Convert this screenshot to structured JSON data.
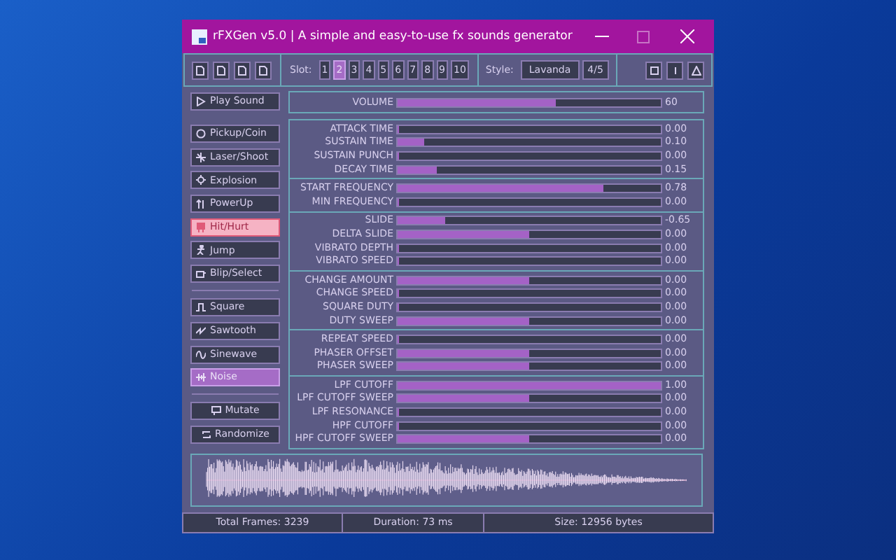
{
  "window": {
    "title": "rFXGen v5.0 | A simple and easy-to-use fx sounds generator"
  },
  "toolbar": {
    "slot_label": "Slot:",
    "slots": [
      {
        "label": "1",
        "selected": false
      },
      {
        "label": "2",
        "selected": true
      },
      {
        "label": "3",
        "selected": false
      },
      {
        "label": "4",
        "selected": false
      },
      {
        "label": "5",
        "selected": false
      },
      {
        "label": "6",
        "selected": false
      },
      {
        "label": "7",
        "selected": false
      },
      {
        "label": "8",
        "selected": false
      },
      {
        "label": "9",
        "selected": false
      },
      {
        "label": "10",
        "selected": false
      }
    ],
    "style_label": "Style:",
    "style_value": "Lavanda",
    "style_index": "4/5"
  },
  "play_button": "Play Sound",
  "presets": [
    {
      "label": "Pickup/Coin",
      "selected": false
    },
    {
      "label": "Laser/Shoot",
      "selected": false
    },
    {
      "label": "Explosion",
      "selected": false
    },
    {
      "label": "PowerUp",
      "selected": false
    },
    {
      "label": "Hit/Hurt",
      "selected": true
    },
    {
      "label": "Jump",
      "selected": false
    },
    {
      "label": "Blip/Select",
      "selected": false
    }
  ],
  "waveforms": [
    {
      "label": "Square",
      "selected": false
    },
    {
      "label": "Sawtooth",
      "selected": false
    },
    {
      "label": "Sinewave",
      "selected": false
    },
    {
      "label": "Noise",
      "selected": true
    }
  ],
  "actions": [
    "Mutate",
    "Randomize"
  ],
  "volume": {
    "label": "VOLUME",
    "level": 0.6,
    "reading": "60"
  },
  "groups": [
    [
      {
        "label": "ATTACK TIME",
        "level": 0,
        "reading": "0.00"
      },
      {
        "label": "SUSTAIN TIME",
        "level": 0.1,
        "reading": "0.10"
      },
      {
        "label": "SUSTAIN PUNCH",
        "level": 0,
        "reading": "0.00"
      },
      {
        "label": "DECAY TIME",
        "level": 0.15,
        "reading": "0.15"
      }
    ],
    [
      {
        "label": "START FREQUENCY",
        "level": 0.78,
        "reading": "0.78"
      },
      {
        "label": "MIN FREQUENCY",
        "level": 0,
        "reading": "0.00"
      }
    ],
    [
      {
        "label": "SLIDE",
        "level": 0.18,
        "reading": "-0.65"
      },
      {
        "label": "DELTA SLIDE",
        "level": 0.5,
        "reading": "0.00"
      },
      {
        "label": "VIBRATO DEPTH",
        "level": 0,
        "reading": "0.00"
      },
      {
        "label": "VIBRATO SPEED",
        "level": 0,
        "reading": "0.00"
      }
    ],
    [
      {
        "label": "CHANGE AMOUNT",
        "level": 0.5,
        "reading": "0.00"
      },
      {
        "label": "CHANGE SPEED",
        "level": 0,
        "reading": "0.00"
      },
      {
        "label": "SQUARE DUTY",
        "level": 0,
        "reading": "0.00"
      },
      {
        "label": "DUTY SWEEP",
        "level": 0.5,
        "reading": "0.00"
      }
    ],
    [
      {
        "label": "REPEAT SPEED",
        "level": 0,
        "reading": "0.00"
      },
      {
        "label": "PHASER OFFSET",
        "level": 0.5,
        "reading": "0.00"
      },
      {
        "label": "PHASER SWEEP",
        "level": 0.5,
        "reading": "0.00"
      }
    ],
    [
      {
        "label": "LPF CUTOFF",
        "level": 1,
        "reading": "1.00"
      },
      {
        "label": "LPF CUTOFF SWEEP",
        "level": 0.5,
        "reading": "0.00"
      },
      {
        "label": "LPF RESONANCE",
        "level": 0,
        "reading": "0.00"
      },
      {
        "label": "HPF CUTOFF",
        "level": 0,
        "reading": "0.00"
      },
      {
        "label": "HPF CUTOFF SWEEP",
        "level": 0.5,
        "reading": "0.00"
      }
    ]
  ],
  "status_bar": [
    "Total Frames: 3239",
    "Duration: 73 ms",
    "Size: 12956 bytes"
  ]
}
